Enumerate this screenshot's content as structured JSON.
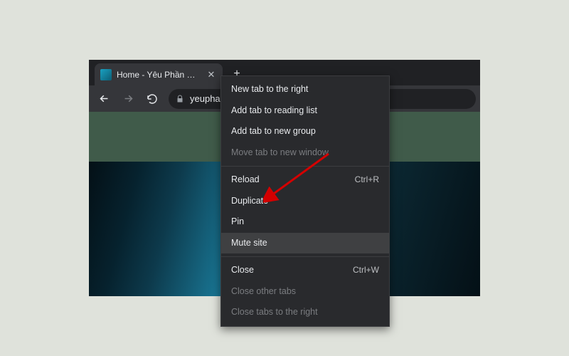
{
  "tab": {
    "title": "Home - Yêu Phần Cứng"
  },
  "toolbar": {
    "url_text": "yeuphar"
  },
  "context_menu": {
    "items": [
      {
        "label": "New tab to the right",
        "shortcut": "",
        "disabled": false
      },
      {
        "label": "Add tab to reading list",
        "shortcut": "",
        "disabled": false
      },
      {
        "label": "Add tab to new group",
        "shortcut": "",
        "disabled": false
      },
      {
        "label": "Move tab to new window",
        "shortcut": "",
        "disabled": true
      }
    ],
    "items2": [
      {
        "label": "Reload",
        "shortcut": "Ctrl+R",
        "disabled": false
      },
      {
        "label": "Duplicate",
        "shortcut": "",
        "disabled": false
      },
      {
        "label": "Pin",
        "shortcut": "",
        "disabled": false
      },
      {
        "label": "Mute site",
        "shortcut": "",
        "disabled": false,
        "highlight": true
      }
    ],
    "items3": [
      {
        "label": "Close",
        "shortcut": "Ctrl+W",
        "disabled": false
      },
      {
        "label": "Close other tabs",
        "shortcut": "",
        "disabled": true
      },
      {
        "label": "Close tabs to the right",
        "shortcut": "",
        "disabled": true
      }
    ]
  }
}
